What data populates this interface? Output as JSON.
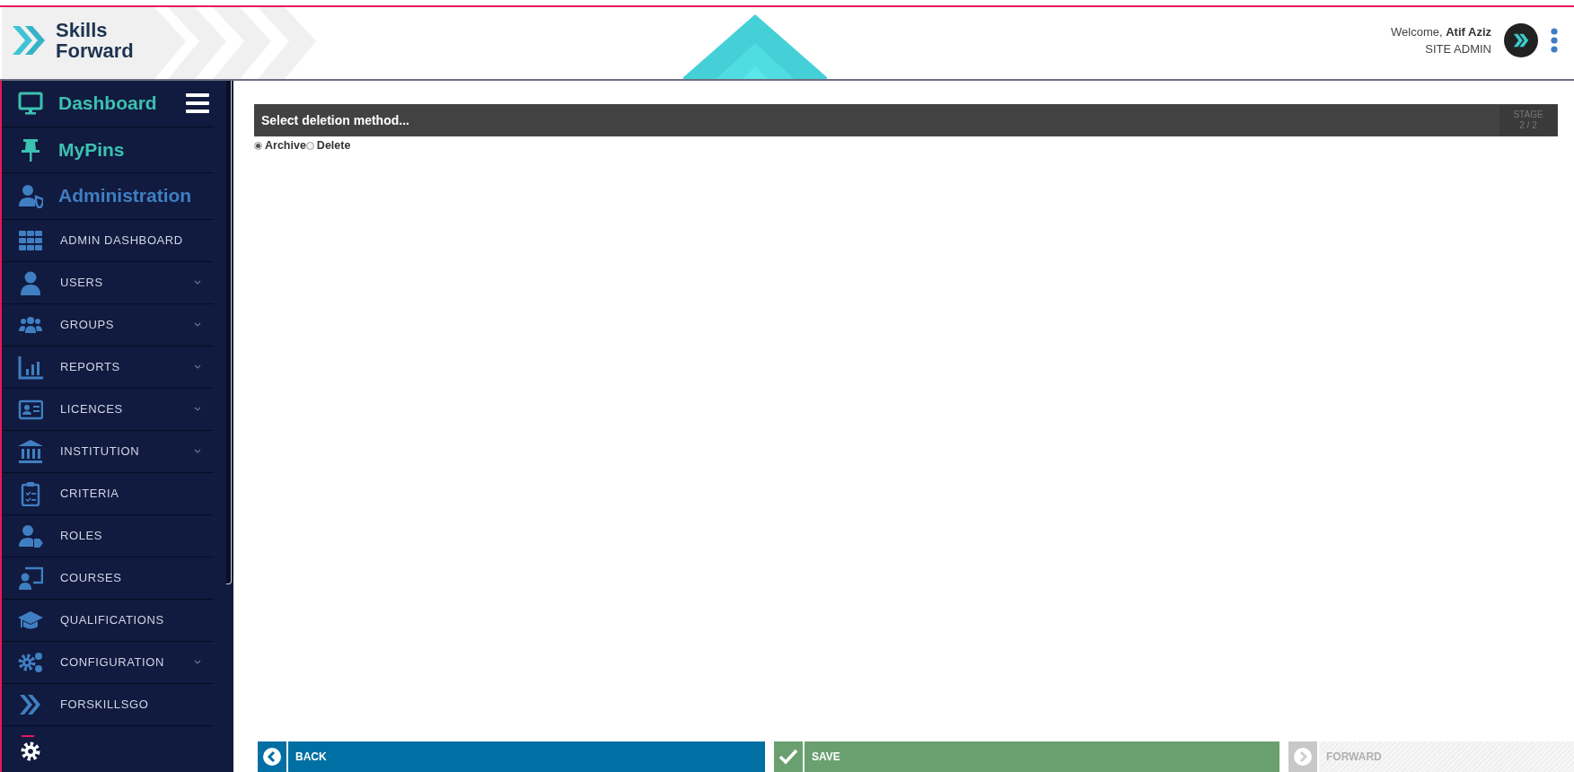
{
  "header": {
    "logo": {
      "line1": "Skills",
      "line2": "Forward"
    },
    "welcome": "Welcome, **Atif Aziz**",
    "role": "SITE ADMIN"
  },
  "sidebar": {
    "items": [
      {
        "kind": "section",
        "label": "Dashboard",
        "color": "#3cc1b0"
      },
      {
        "kind": "section",
        "label": "**My**Pins",
        "color": "#3cc1b0"
      },
      {
        "kind": "section",
        "label": "Administration",
        "color": "#3f7fc1"
      },
      {
        "kind": "item",
        "label": "ADMIN DASHBOARD",
        "expandable": false
      },
      {
        "kind": "item",
        "label": "USERS",
        "expandable": true
      },
      {
        "kind": "item",
        "label": "GROUPS",
        "expandable": true
      },
      {
        "kind": "item",
        "label": "REPORTS",
        "expandable": true
      },
      {
        "kind": "item",
        "label": "LICENCES",
        "expandable": true
      },
      {
        "kind": "item",
        "label": "INSTITUTION",
        "expandable": true
      },
      {
        "kind": "item",
        "label": "CRITERIA",
        "expandable": false
      },
      {
        "kind": "item",
        "label": "ROLES",
        "expandable": false
      },
      {
        "kind": "item",
        "label": "COURSES",
        "expandable": false
      },
      {
        "kind": "item",
        "label": "QUALIFICATIONS",
        "expandable": false
      },
      {
        "kind": "item",
        "label": "CONFIGURATION",
        "expandable": true
      },
      {
        "kind": "item",
        "label": "FORSKILLSGO",
        "expandable": false
      }
    ]
  },
  "panel": {
    "title": "Select deletion method...",
    "stage_label": "STAGE",
    "stage": "2 / 2",
    "options": [
      {
        "label": "Archive",
        "selected": true
      },
      {
        "label": "Delete",
        "selected": false
      }
    ]
  },
  "footer": {
    "buttons": [
      {
        "kind": "back",
        "label": "BACK",
        "disabled": false
      },
      {
        "kind": "save",
        "label": "SAVE",
        "disabled": false
      },
      {
        "kind": "forward",
        "label": "FORWARD",
        "disabled": true
      }
    ]
  }
}
